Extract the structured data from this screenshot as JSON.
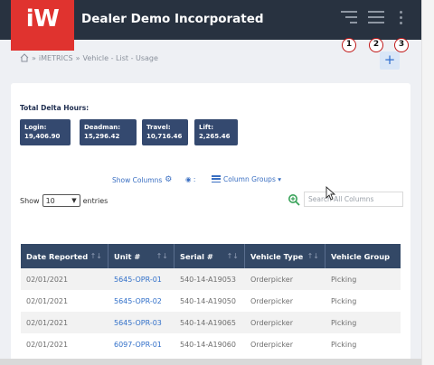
{
  "header": {
    "logo_text": "iW",
    "company": "Dealer Demo Incorporated",
    "callouts": [
      "1",
      "2",
      "3"
    ]
  },
  "breadcrumb": {
    "items": [
      "iMETRICS",
      "Vehicle - List - Usage"
    ],
    "separator": "»"
  },
  "add_button": "+",
  "delta": {
    "title": "Total Delta Hours:",
    "stats": [
      {
        "label": "Login:",
        "value": "19,406.90"
      },
      {
        "label": "Deadman:",
        "value": "15,296.42"
      },
      {
        "label": "Travel:",
        "value": "10,716.46"
      },
      {
        "label": "Lift:",
        "value": "2,265.46"
      }
    ]
  },
  "toolbar": {
    "show_columns": "Show Columns",
    "eye_label": "◉ :",
    "column_groups": "Column Groups ▾"
  },
  "entries": {
    "show": "Show",
    "value": "10",
    "suffix": "entries"
  },
  "search": {
    "placeholder": "Search All Columns"
  },
  "table": {
    "headers": [
      "Date Reported",
      "Unit #",
      "Serial #",
      "Vehicle Type",
      "Vehicle Group"
    ],
    "sort_glyph": "↑↓",
    "rows": [
      [
        "02/01/2021",
        "5645-OPR-01",
        "540-14-A19053",
        "Orderpicker",
        "Picking"
      ],
      [
        "02/01/2021",
        "5645-OPR-02",
        "540-14-A19050",
        "Orderpicker",
        "Picking"
      ],
      [
        "02/01/2021",
        "5645-OPR-03",
        "540-14-A19065",
        "Orderpicker",
        "Picking"
      ],
      [
        "02/01/2021",
        "6097-OPR-01",
        "540-14-A19060",
        "Orderpicker",
        "Picking"
      ]
    ]
  },
  "colors": {
    "header_bg": "#283240",
    "logo_red": "#e0332f",
    "stat_bg": "#34496f",
    "link_blue": "#3270c9"
  }
}
